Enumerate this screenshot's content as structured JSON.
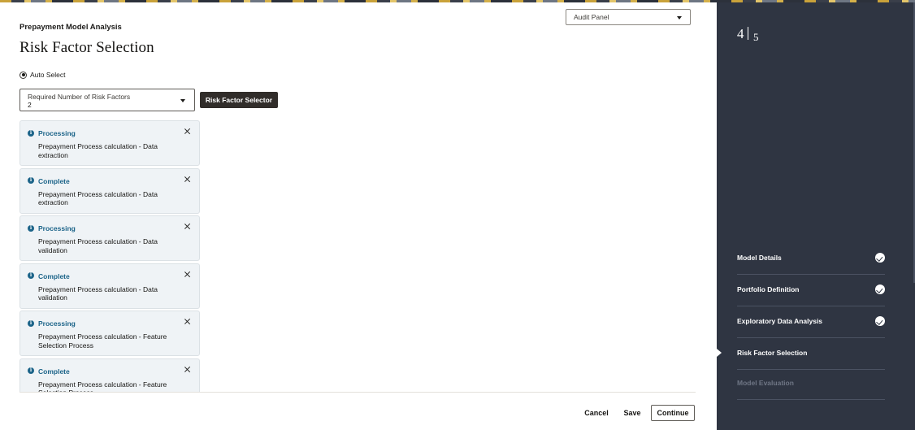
{
  "header": {
    "eyebrow": "Prepayment Model Analysis",
    "title": "Risk Factor Selection",
    "audit_panel": {
      "value": "Audit Panel"
    }
  },
  "form": {
    "auto_select": {
      "label": "Auto Select",
      "checked": true
    },
    "required_factors": {
      "label": "Required Number of Risk Factors",
      "value": "2"
    },
    "selector_button": "Risk Factor Selector"
  },
  "messages": [
    {
      "status": "Processing",
      "text": "Prepayment Process calculation - Data extraction"
    },
    {
      "status": "Complete",
      "text": "Prepayment Process calculation - Data extraction"
    },
    {
      "status": "Processing",
      "text": "Prepayment Process calculation - Data validation"
    },
    {
      "status": "Complete",
      "text": "Prepayment Process calculation - Data validation"
    },
    {
      "status": "Processing",
      "text": "Prepayment Process calculation - Feature Selection Process"
    },
    {
      "status": "Complete",
      "text": "Prepayment Process calculation - Feature Selection Process"
    }
  ],
  "footer": {
    "cancel": "Cancel",
    "save": "Save",
    "continue": "Continue"
  },
  "train": {
    "current": "4",
    "total": "5",
    "steps": [
      {
        "label": "Model Details",
        "state": "complete"
      },
      {
        "label": "Portfolio Definition",
        "state": "complete"
      },
      {
        "label": "Exploratory Data Analysis",
        "state": "complete"
      },
      {
        "label": "Risk Factor Selection",
        "state": "current"
      },
      {
        "label": "Model Evaluation",
        "state": "disabled"
      }
    ]
  },
  "colors": {
    "sidebar_bg": "#2f3542",
    "info_accent": "#1c6489",
    "primary_button": "#312d2a",
    "message_bg": "#eff3f6"
  }
}
